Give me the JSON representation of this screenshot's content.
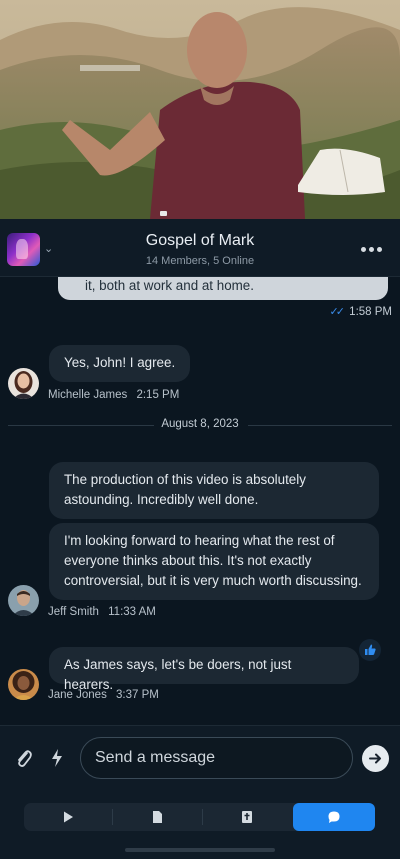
{
  "video": {
    "description_icons": [
      "video-frame"
    ]
  },
  "header": {
    "title": "Gospel of Mark",
    "subtitle": "14 Members, 5 Online"
  },
  "messages": {
    "own_partial": "it, both at work and at home.",
    "own_time": "1:58 PM",
    "michelle": {
      "text": "Yes, John! I agree.",
      "name": "Michelle James",
      "time": "2:15 PM"
    },
    "date_divider": "August 8, 2023",
    "jeff": {
      "msg1": "The production of this video is absolutely astounding. Incredibly well done.",
      "msg2": "I'm looking forward to hearing what the rest of everyone thinks about this. It's not exactly controversial, but it is very much worth discussing.",
      "name": "Jeff Smith",
      "time": "11:33 AM"
    },
    "jane": {
      "text": "As James says, let's be doers, not just hearers.",
      "name": "Jane Jones",
      "time": "3:37 PM"
    }
  },
  "composer": {
    "placeholder": "Send a message"
  },
  "tabs": [
    "play-icon",
    "document-icon",
    "bible-icon",
    "chat-icon"
  ],
  "colors": {
    "accent": "#1f86f0",
    "background": "#0b1620"
  }
}
